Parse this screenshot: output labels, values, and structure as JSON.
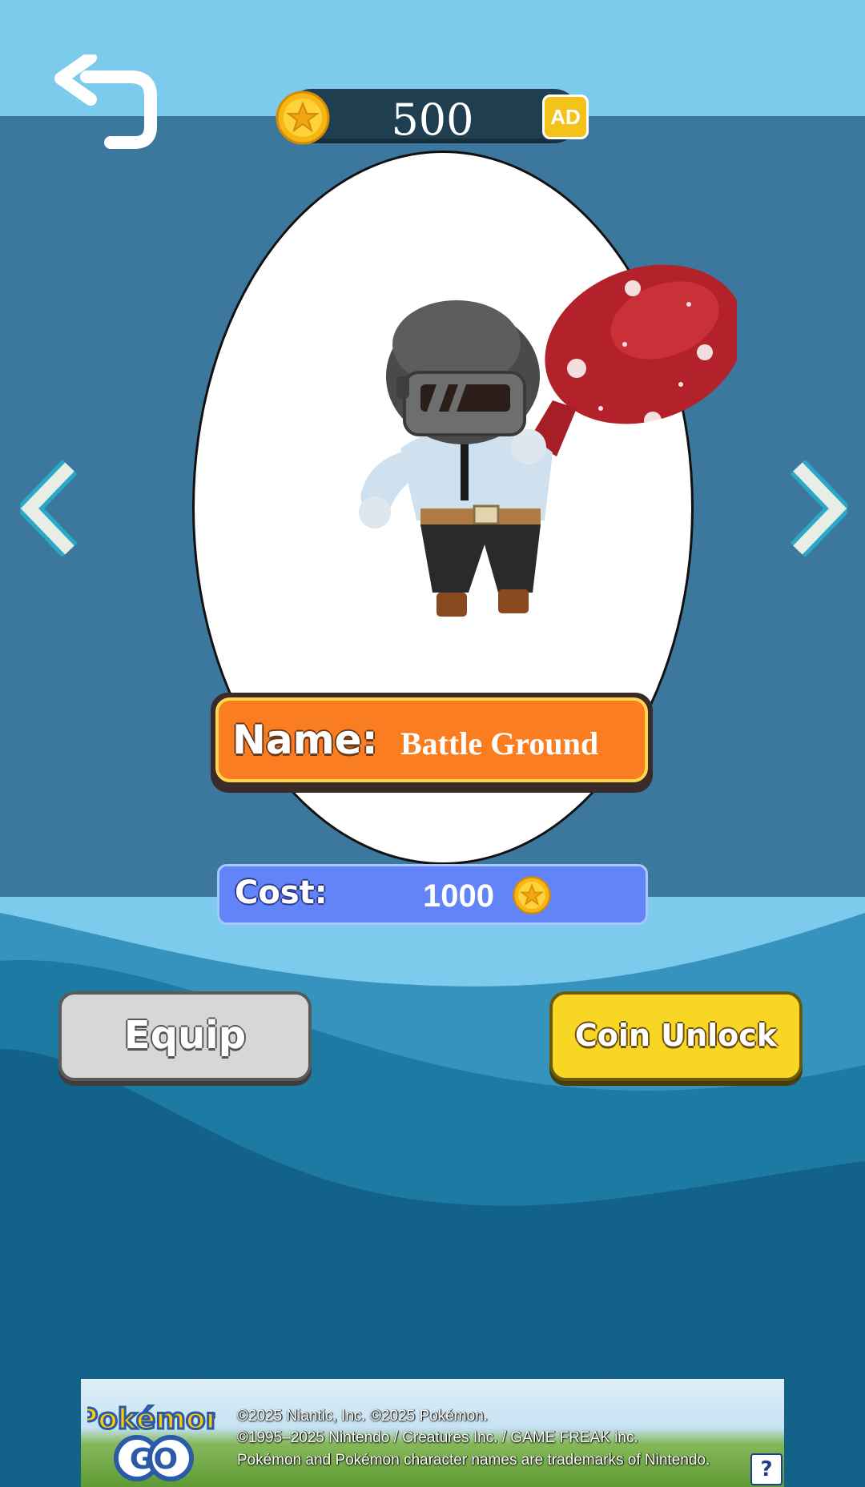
{
  "header": {
    "coins": "500",
    "ad_label": "AD"
  },
  "skin": {
    "name_label": "Name:",
    "name": "Battle Ground",
    "cost_label": "Cost:",
    "cost": "1000"
  },
  "buttons": {
    "equip": "Equip",
    "coin_unlock": "Coin Unlock"
  },
  "ad_banner": {
    "lines": [
      "©2025 Niantic, Inc. ©2025 Pokémon.",
      "©1995–2025 Nintendo / Creatures Inc. / GAME FREAK inc.",
      "Pokémon and Pokémon character names are trademarks of Nintendo."
    ],
    "logo_text_top": "Pokémon",
    "logo_text_bottom": "GO",
    "help": "?"
  },
  "colors": {
    "sky": "#7ccbec",
    "background": "#3c789e",
    "name_panel": "#fb7d22",
    "cost_panel": "#6383f8",
    "equip_button": "#d7d7d7",
    "unlock_button": "#f8d624"
  },
  "icons": [
    "back-arrow-icon",
    "coin-icon",
    "chevron-left-icon",
    "chevron-right-icon",
    "help-icon"
  ]
}
